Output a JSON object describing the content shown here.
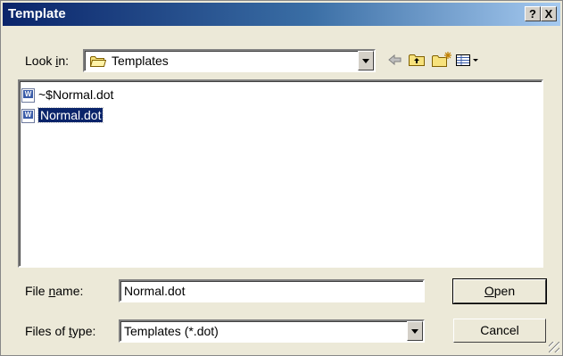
{
  "window": {
    "title": "Template",
    "help_label": "?",
    "close_label": "X"
  },
  "lookin": {
    "label": "Look in:",
    "label_pre": "Look ",
    "label_u": "i",
    "label_post": "n:",
    "value": "Templates",
    "icon": "folder-icon"
  },
  "toolbar": {
    "back_icon": "back-arrow-icon",
    "up_icon": "up-folder-icon",
    "new_folder_icon": "new-folder-icon",
    "views_icon": "views-menu-icon"
  },
  "files": [
    {
      "name": "~$Normal.dot",
      "icon": "word-template-icon",
      "selected": false
    },
    {
      "name": "Normal.dot",
      "icon": "word-template-icon",
      "selected": true
    }
  ],
  "filename": {
    "label_pre": "File ",
    "label_u": "n",
    "label_post": "ame:",
    "value": "Normal.dot"
  },
  "filetype": {
    "label_pre": "Files of ",
    "label_u": "t",
    "label_post": "ype:",
    "value": "Templates (*.dot)"
  },
  "buttons": {
    "open_u": "O",
    "open_rest": "pen",
    "cancel": "Cancel"
  },
  "colors": {
    "title_start": "#0a246a",
    "title_end": "#a6caf0",
    "selection": "#0a246a",
    "dialog_bg": "#ece9d8"
  }
}
